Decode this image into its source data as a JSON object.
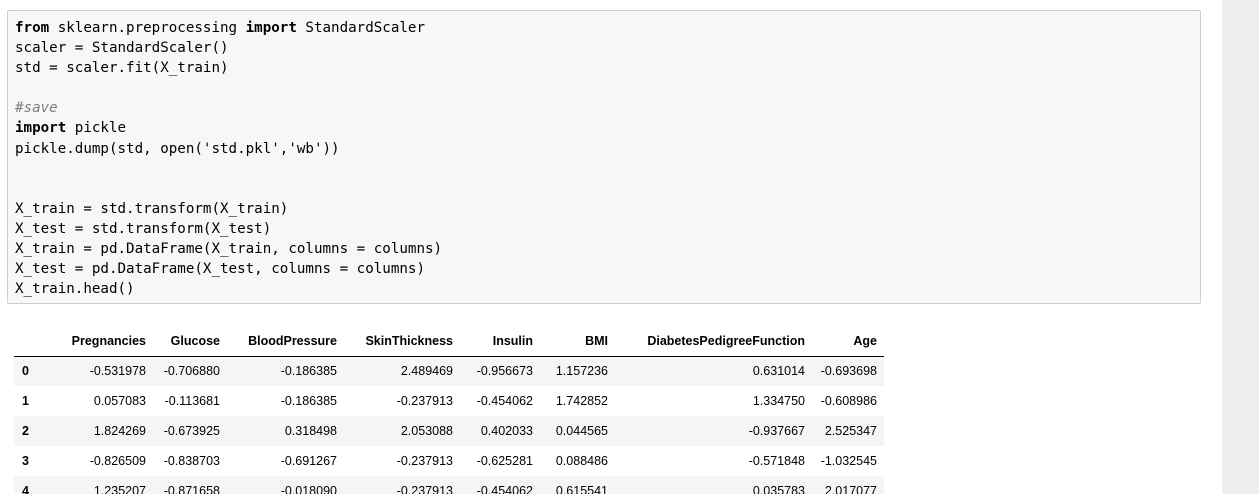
{
  "code_cell": {
    "lines": [
      [
        {
          "t": "kw",
          "v": "from"
        },
        {
          "t": "",
          "v": " sklearn.preprocessing "
        },
        {
          "t": "kw",
          "v": "import"
        },
        {
          "t": "",
          "v": " StandardScaler"
        }
      ],
      [
        {
          "t": "",
          "v": "scaler = StandardScaler()"
        }
      ],
      [
        {
          "t": "",
          "v": "std = scaler.fit(X_train)"
        }
      ],
      [
        {
          "t": "",
          "v": ""
        }
      ],
      [
        {
          "t": "cm",
          "v": "#save"
        }
      ],
      [
        {
          "t": "kw",
          "v": "import"
        },
        {
          "t": "",
          "v": " pickle"
        }
      ],
      [
        {
          "t": "",
          "v": "pickle.dump(std, open('std.pkl','wb'))"
        }
      ],
      [
        {
          "t": "",
          "v": ""
        }
      ],
      [
        {
          "t": "",
          "v": ""
        }
      ],
      [
        {
          "t": "",
          "v": "X_train = std.transform(X_train)"
        }
      ],
      [
        {
          "t": "",
          "v": "X_test = std.transform(X_test)"
        }
      ],
      [
        {
          "t": "",
          "v": "X_train = pd.DataFrame(X_train, columns = columns)"
        }
      ],
      [
        {
          "t": "",
          "v": "X_test = pd.DataFrame(X_test, columns = columns)"
        }
      ],
      [
        {
          "t": "",
          "v": "X_train.head()"
        }
      ]
    ]
  },
  "output_table": {
    "columns": [
      "",
      "Pregnancies",
      "Glucose",
      "BloodPressure",
      "SkinThickness",
      "Insulin",
      "BMI",
      "DiabetesPedigreeFunction",
      "Age"
    ],
    "rows": [
      {
        "index": "0",
        "values": [
          "-0.531978",
          "-0.706880",
          "-0.186385",
          "2.489469",
          "-0.956673",
          "1.157236",
          "0.631014",
          "-0.693698"
        ]
      },
      {
        "index": "1",
        "values": [
          "0.057083",
          "-0.113681",
          "-0.186385",
          "-0.237913",
          "-0.454062",
          "1.742852",
          "1.334750",
          "-0.608986"
        ]
      },
      {
        "index": "2",
        "values": [
          "1.824269",
          "-0.673925",
          "0.318498",
          "2.053088",
          "0.402033",
          "0.044565",
          "-0.937667",
          "2.525347"
        ]
      },
      {
        "index": "3",
        "values": [
          "-0.826509",
          "-0.838703",
          "-0.691267",
          "-0.237913",
          "-0.625281",
          "0.088486",
          "-0.571848",
          "-1.032545"
        ]
      },
      {
        "index": "4",
        "values": [
          "1.235207",
          "-0.871658",
          "-0.018090",
          "-0.237913",
          "-0.454062",
          "0.615541",
          "0.035783",
          "2.017077"
        ]
      }
    ]
  }
}
